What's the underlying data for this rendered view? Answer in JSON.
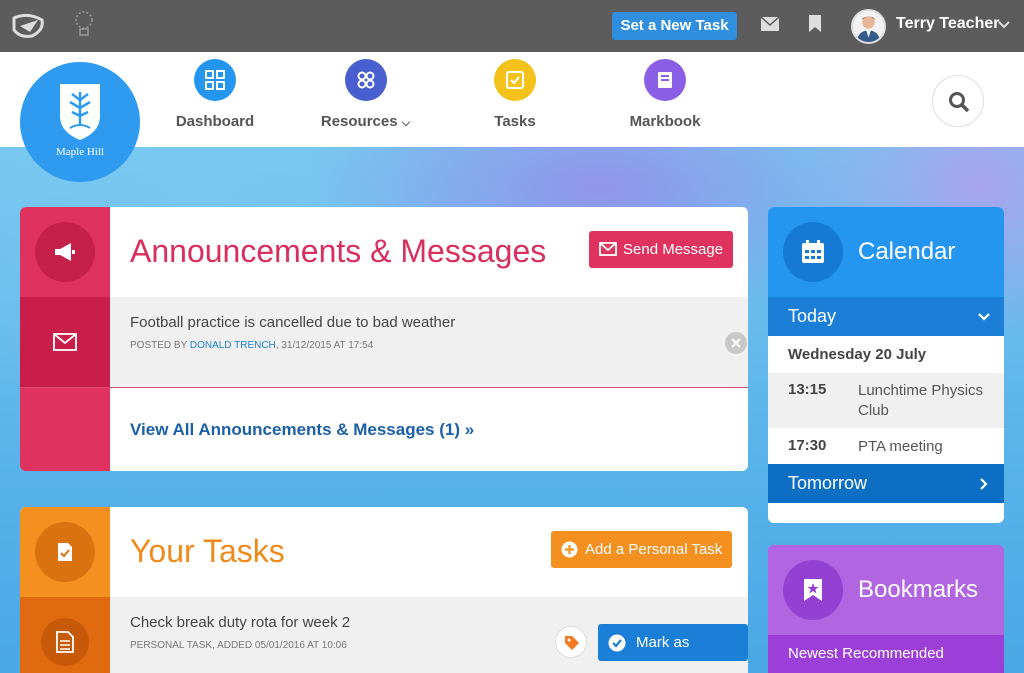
{
  "topbar": {
    "new_task_label": "Set a New Task",
    "user_name": "Terry Teacher"
  },
  "school": {
    "name": "Maple Hill"
  },
  "nav": [
    {
      "label": "Dashboard",
      "icon": "grid-icon",
      "color": "#2596ef"
    },
    {
      "label": "Resources",
      "icon": "resources-icon",
      "color": "#4a5fcf"
    },
    {
      "label": "Tasks",
      "icon": "check-square-icon",
      "color": "#f5c21b"
    },
    {
      "label": "Markbook",
      "icon": "book-icon",
      "color": "#8b5ee6"
    }
  ],
  "announcements": {
    "title": "Announcements & Messages",
    "send_label": "Send Message",
    "item": {
      "title": "Football practice is cancelled due to bad weather",
      "meta_prefix": "POSTED BY ",
      "author": "DONALD TRENCH",
      "meta_suffix": ", 31/12/2015 AT 17:54"
    },
    "view_all": "View All Announcements & Messages (1) »",
    "accent": "#e0325e"
  },
  "tasks": {
    "title": "Your Tasks",
    "add_label": "Add a Personal Task",
    "item": {
      "title": "Check break duty rota for week 2",
      "meta": "PERSONAL TASK, ADDED 05/01/2016 AT 10:06"
    },
    "done_label": "Mark as Done",
    "accent": "#f3901f"
  },
  "calendar": {
    "title": "Calendar",
    "today_label": "Today",
    "date_label": "Wednesday 20 July",
    "events": [
      {
        "time": "13:15",
        "name": "Lunchtime Physics Club"
      },
      {
        "time": "17:30",
        "name": "PTA meeting"
      }
    ],
    "tomorrow_label": "Tomorrow"
  },
  "bookmarks": {
    "title": "Bookmarks",
    "sub_label": "Newest Recommended"
  }
}
